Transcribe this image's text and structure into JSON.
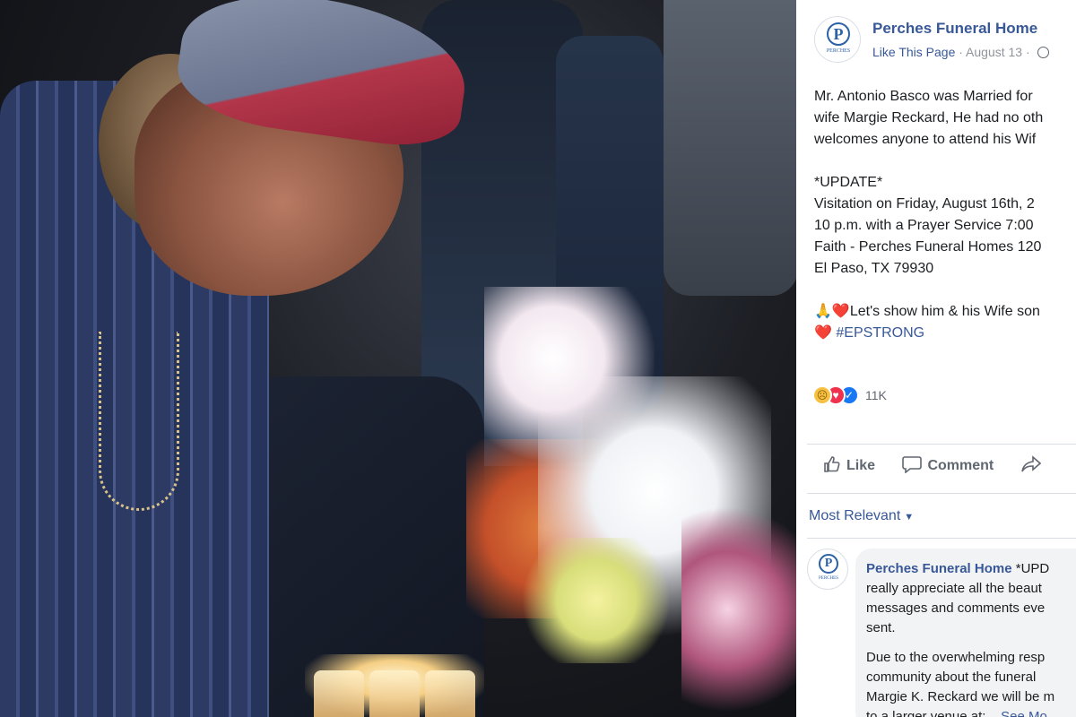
{
  "post": {
    "page_name": "Perches Funeral Home",
    "logo_letter": "P",
    "logo_caption": "PERCHES",
    "like_link": "Like This Page",
    "separator": " · ",
    "date": "August 13",
    "separator2": " · ",
    "text_lines": [
      "Mr. Antonio Basco was Married for",
      "wife Margie Reckard, He had no oth",
      "welcomes anyone to attend his Wif"
    ],
    "update_lines": [
      "*UPDATE*",
      "Visitation on Friday, August 16th, 2",
      "10 p.m. with a Prayer Service 7:00",
      "Faith - Perches Funeral Homes 120",
      "El Paso, TX 79930"
    ],
    "closing_line1_emoji": "🙏",
    "closing_line1_heart": "❤️",
    "closing_line1_text": "Let's show him & his Wife son",
    "closing_line2_heart": "❤️",
    "hashtag": "#EPSTRONG"
  },
  "reactions": {
    "icons": [
      "sad-reaction",
      "love-reaction",
      "like-reaction"
    ],
    "count": "11K"
  },
  "actions": {
    "like": "Like",
    "comment": "Comment"
  },
  "comments_filter": {
    "label": "Most Relevant",
    "caret": "▼"
  },
  "comment": {
    "author": "Perches Funeral Home",
    "line1_rest": " *UPD",
    "lines": [
      "really appreciate all the beaut",
      "messages and comments eve",
      "sent."
    ],
    "lines2": [
      "Due to the overwhelming resp",
      "community about the funeral",
      "Margie K. Reckard we will be m"
    ],
    "last_line": "to a larger venue at:...",
    "see_more": "See Mo"
  },
  "colors": {
    "link_blue": "#385898",
    "text": "#1c1e21",
    "muted": "#606770",
    "heart_red": "#e0283a"
  }
}
